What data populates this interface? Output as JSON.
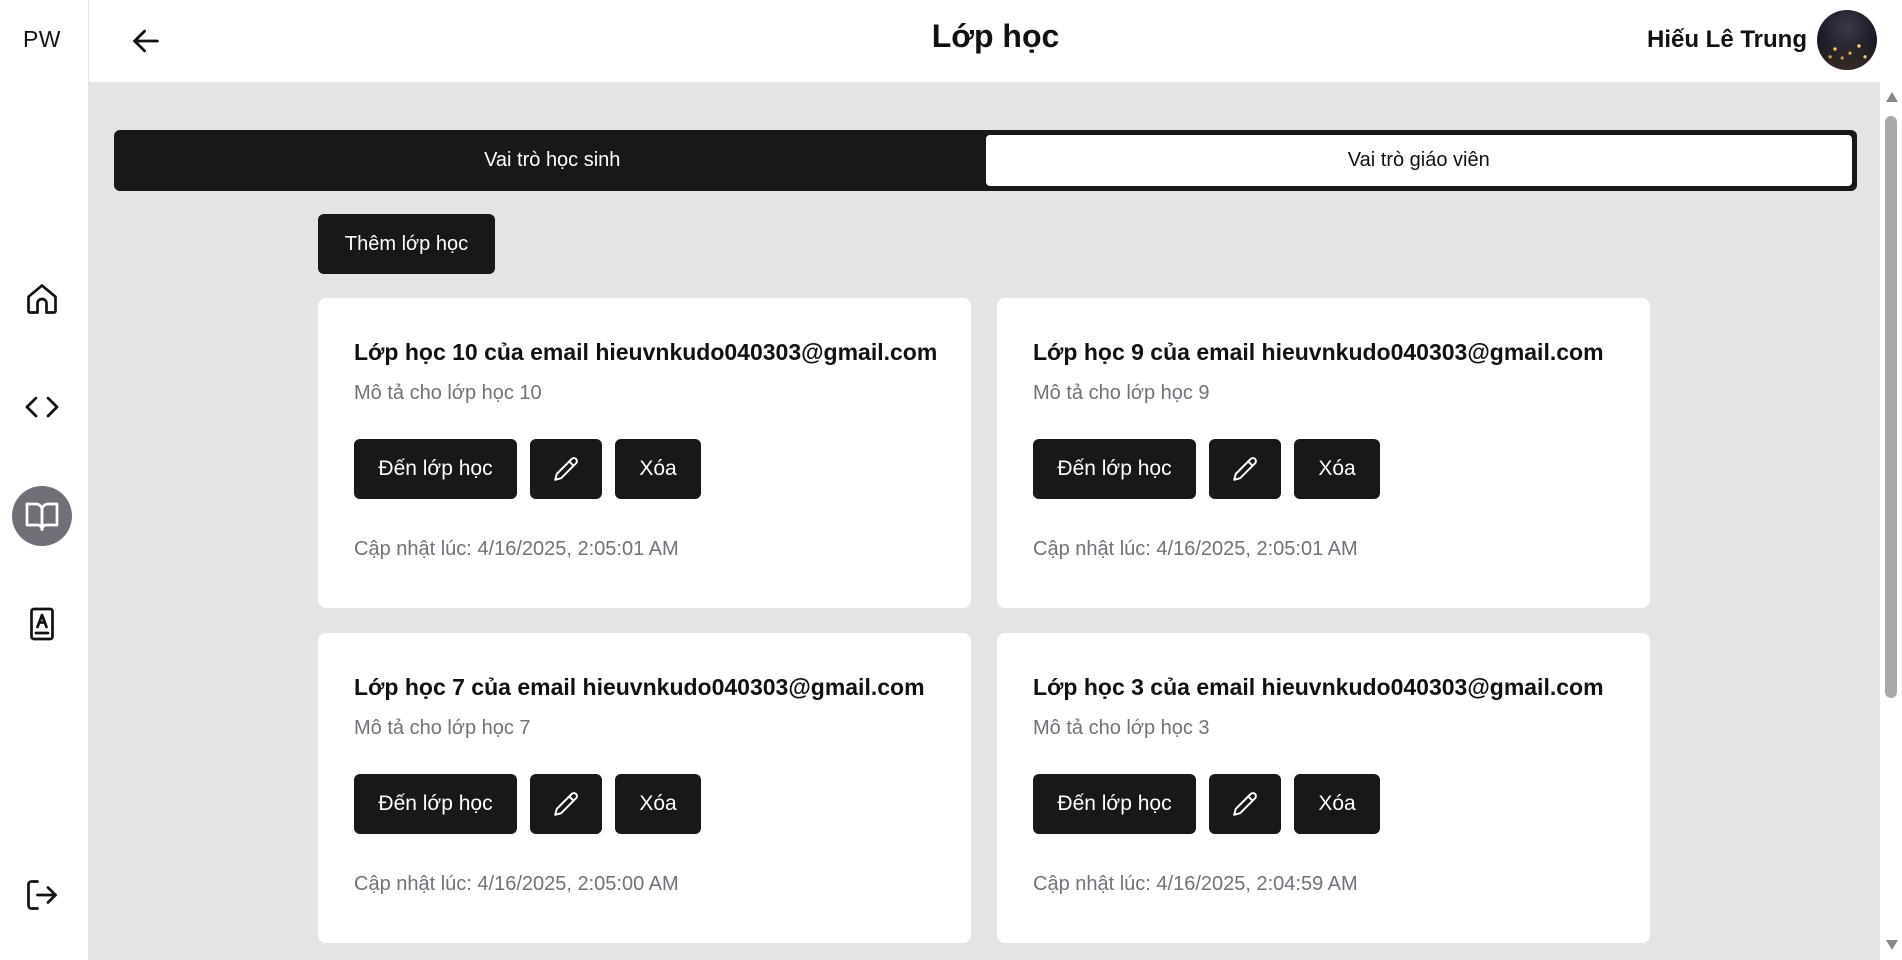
{
  "app": {
    "logo": "PW"
  },
  "sidebar": {
    "items": [
      {
        "name": "home",
        "icon": "home-icon",
        "active": false
      },
      {
        "name": "code",
        "icon": "code-icon",
        "active": false
      },
      {
        "name": "classes",
        "icon": "book-open-icon",
        "active": true
      },
      {
        "name": "contacts",
        "icon": "contact-book-icon",
        "active": false
      }
    ],
    "logout_icon": "logout-icon"
  },
  "header": {
    "back_icon": "arrow-left-icon",
    "title": "Lớp học",
    "user_name": "Hiếu Lê Trung"
  },
  "tabs": [
    {
      "label": "Vai trò học sinh",
      "active": false
    },
    {
      "label": "Vai trò giáo viên",
      "active": true
    }
  ],
  "add_button": "Thêm lớp học",
  "cards": [
    {
      "title": "Lớp học 10 của email hieuvnkudo040303@gmail.com",
      "description": "Mô tả cho lớp học 10",
      "go_label": "Đến lớp học",
      "delete_label": "Xóa",
      "updated": "Cập nhật lúc: 4/16/2025, 2:05:01 AM"
    },
    {
      "title": "Lớp học 9 của email hieuvnkudo040303@gmail.com",
      "description": "Mô tả cho lớp học 9",
      "go_label": "Đến lớp học",
      "delete_label": "Xóa",
      "updated": "Cập nhật lúc: 4/16/2025, 2:05:01 AM"
    },
    {
      "title": "Lớp học 7 của email hieuvnkudo040303@gmail.com",
      "description": "Mô tả cho lớp học 7",
      "go_label": "Đến lớp học",
      "delete_label": "Xóa",
      "updated": "Cập nhật lúc: 4/16/2025, 2:05:00 AM"
    },
    {
      "title": "Lớp học 3 của email hieuvnkudo040303@gmail.com",
      "description": "Mô tả cho lớp học 3",
      "go_label": "Đến lớp học",
      "delete_label": "Xóa",
      "updated": "Cập nhật lúc: 4/16/2025, 2:04:59 AM"
    }
  ]
}
